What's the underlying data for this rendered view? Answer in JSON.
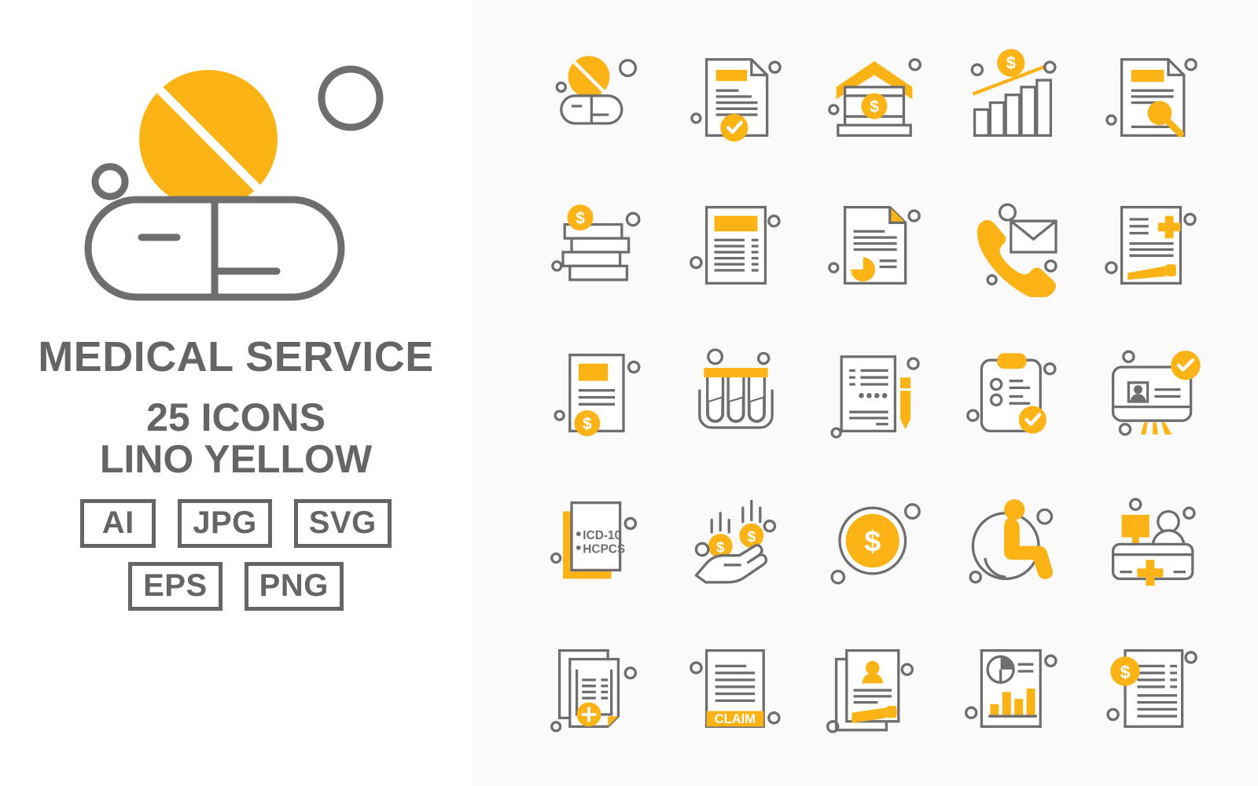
{
  "cover": {
    "title": "MEDICAL SERVICE",
    "count_line": "25 ICONS",
    "style_line": "LINO YELLOW",
    "formats_row1": [
      "AI",
      "JPG",
      "SVG"
    ],
    "formats_row2": [
      "EPS",
      "PNG"
    ],
    "logo_name": "pill-and-capsule-logo"
  },
  "colors": {
    "accent_yellow": "#FCB316",
    "stroke_gray": "#6E6E6E",
    "cover_background": "#FFFFFF",
    "grid_background": "#FAFAFA"
  },
  "grid": {
    "rows": 5,
    "columns": 5,
    "total_icons": 25,
    "icons": [
      {
        "index": 1,
        "name": "pill-medicine-icon",
        "label": "Medicine"
      },
      {
        "index": 2,
        "name": "approved-document-icon",
        "label": "Approved Document"
      },
      {
        "index": 3,
        "name": "bank-dollar-icon",
        "label": "Bank"
      },
      {
        "index": 4,
        "name": "growth-chart-dollar-icon",
        "label": "Revenue Growth"
      },
      {
        "index": 5,
        "name": "document-search-icon",
        "label": "Document Search"
      },
      {
        "index": 6,
        "name": "money-stack-coin-icon",
        "label": "Money Stack"
      },
      {
        "index": 7,
        "name": "invoice-document-icon",
        "label": "Invoice"
      },
      {
        "index": 8,
        "name": "pie-chart-report-icon",
        "label": "Report"
      },
      {
        "index": 9,
        "name": "phone-email-contact-icon",
        "label": "Contact"
      },
      {
        "index": 10,
        "name": "prescription-document-icon",
        "label": "Prescription"
      },
      {
        "index": 11,
        "name": "payment-document-dollar-icon",
        "label": "Payment Document"
      },
      {
        "index": 12,
        "name": "test-tubes-icon",
        "label": "Lab Test Tubes"
      },
      {
        "index": 13,
        "name": "form-with-pencil-icon",
        "label": "Form"
      },
      {
        "index": 14,
        "name": "checklist-clipboard-icon",
        "label": "Checklist"
      },
      {
        "index": 15,
        "name": "id-verification-card-icon",
        "label": "ID Verification"
      },
      {
        "index": 16,
        "name": "medical-coding-icon",
        "label": "Medical Coding",
        "text_lines": [
          "ICD-10",
          "HCPCS"
        ]
      },
      {
        "index": 17,
        "name": "hand-receiving-coins-icon",
        "label": "Payout"
      },
      {
        "index": 18,
        "name": "dollar-coin-icon",
        "label": "Dollar Coin"
      },
      {
        "index": 19,
        "name": "wheelchair-accessibility-icon",
        "label": "Accessibility"
      },
      {
        "index": 20,
        "name": "reception-desk-icon",
        "label": "Reception Desk"
      },
      {
        "index": 21,
        "name": "medical-records-plus-icon",
        "label": "Medical Records"
      },
      {
        "index": 22,
        "name": "insurance-claim-form-icon",
        "label": "Claim Form",
        "text_lines": [
          "CLAIM"
        ]
      },
      {
        "index": 23,
        "name": "patient-record-pencil-icon",
        "label": "Patient Record"
      },
      {
        "index": 24,
        "name": "analytics-report-icon",
        "label": "Analytics Report"
      },
      {
        "index": 25,
        "name": "billing-statement-dollar-icon",
        "label": "Billing Statement"
      }
    ]
  }
}
